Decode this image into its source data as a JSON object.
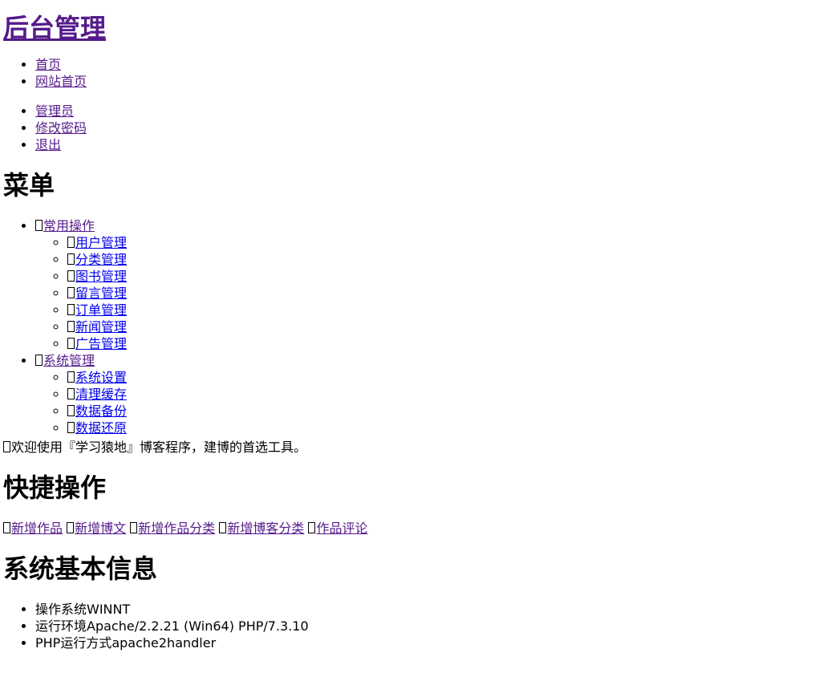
{
  "header": {
    "title": "后台管理"
  },
  "topnav": [
    {
      "label": "首页"
    },
    {
      "label": "网站首页"
    }
  ],
  "usernav": [
    {
      "label": "管理员"
    },
    {
      "label": "修改密码"
    },
    {
      "label": "退出"
    }
  ],
  "menu": {
    "title": "菜单",
    "groups": [
      {
        "label": "常用操作",
        "icon": "box-icon",
        "items": [
          {
            "label": "用户管理",
            "icon": "box-icon"
          },
          {
            "label": "分类管理",
            "icon": "box-icon"
          },
          {
            "label": "图书管理",
            "icon": "box-icon"
          },
          {
            "label": "留言管理",
            "icon": "box-icon"
          },
          {
            "label": "订单管理",
            "icon": "box-icon"
          },
          {
            "label": "新闻管理",
            "icon": "box-icon"
          },
          {
            "label": "广告管理",
            "icon": "box-icon"
          }
        ]
      },
      {
        "label": "系统管理",
        "icon": "box-icon",
        "items": [
          {
            "label": "系统设置",
            "icon": "box-icon"
          },
          {
            "label": "清理缓存",
            "icon": "box-icon"
          },
          {
            "label": "数据备份",
            "icon": "box-icon"
          },
          {
            "label": "数据还原",
            "icon": "box-icon"
          }
        ]
      }
    ]
  },
  "welcome": "欢迎使用『学习猿地』博客程序，建博的首选工具。",
  "quick": {
    "title": "快捷操作",
    "links": [
      {
        "label": "新增作品"
      },
      {
        "label": "新增博文"
      },
      {
        "label": "新增作品分类"
      },
      {
        "label": "新增博客分类"
      },
      {
        "label": "作品评论"
      }
    ]
  },
  "sysinfo": {
    "title": "系统基本信息",
    "items": [
      {
        "label": "操作系统WINNT"
      },
      {
        "label": "运行环境Apache/2.2.21 (Win64) PHP/7.3.10"
      },
      {
        "label": "PHP运行方式apache2handler"
      }
    ]
  }
}
